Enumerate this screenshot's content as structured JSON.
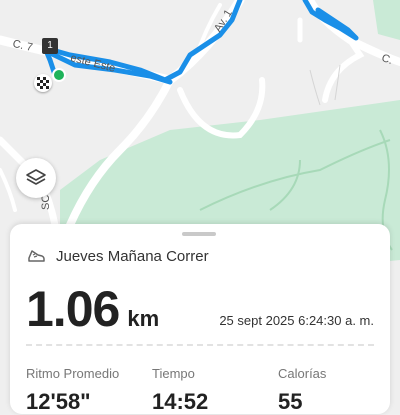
{
  "map": {
    "streets": {
      "c7": "C. 7",
      "av": "Av. 1",
      "c_right": "C."
    },
    "route_label": "este Este",
    "street_sc": "SC",
    "lap_marker": "1",
    "icons": {
      "finish": "checkered-flag-icon",
      "start": "start-point-icon",
      "layers": "layers-icon"
    },
    "colors": {
      "route": "#1a8fe8",
      "park": "#c9ead6",
      "road": "#ffffff",
      "start": "#1fb35a"
    }
  },
  "card": {
    "activity_icon": "running-shoe-icon",
    "title": "Jueves Mañana Correr",
    "distance_value": "1.06",
    "distance_unit": "km",
    "date": "25 sept 2025 6:24:30 a. m.",
    "stats": [
      {
        "label": "Ritmo Promedio",
        "value": "12'58\""
      },
      {
        "label": "Tiempo",
        "value": "14:52"
      },
      {
        "label": "Calorías",
        "value": "55"
      }
    ]
  }
}
